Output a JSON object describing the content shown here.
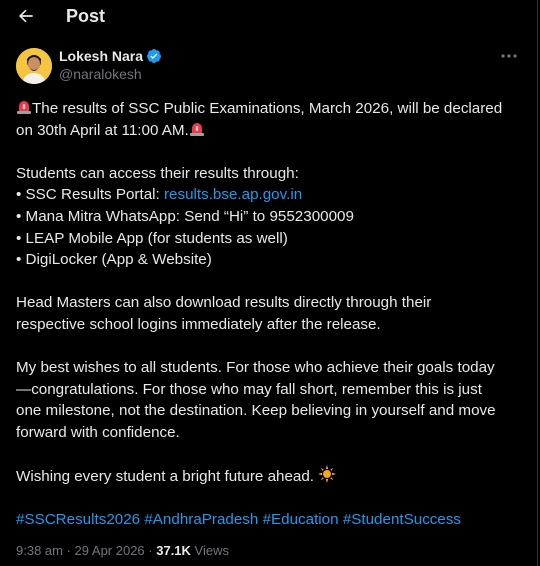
{
  "header": {
    "title": "Post"
  },
  "author": {
    "display_name": "Lokesh Nara",
    "handle": "@naralokesh",
    "verified": true
  },
  "tweet": {
    "line1_part1": "The results of SSC Public Examinations, March 2026, will be declared",
    "line1_part2": "on 30th April at 11:00 AM.",
    "access_intro": "Students can access their results through:",
    "item1_prefix": "• SSC Results Portal: ",
    "item1_link": "results.bse.ap.gov.in",
    "item2": "• Mana Mitra WhatsApp: Send “Hi” to 9552300009",
    "item3": "• LEAP Mobile App (for students as well)",
    "item4": "• DigiLocker (App & Website)",
    "headmasters_l1": "Head Masters can also download results directly through their",
    "headmasters_l2": "respective school logins immediately after the release.",
    "wishes_l1": "My best wishes to all students. For those who achieve their goals today",
    "wishes_l2": "—congratulations. For those who may fall short, remember this is just",
    "wishes_l3": "one milestone, not the destination. Keep believing in yourself and move",
    "wishes_l4": "forward with confidence.",
    "closing": "Wishing every student a bright future ahead. ",
    "hashtags": [
      "#SSCResults2026",
      "#AndhraPradesh",
      "#Education",
      "#StudentSuccess"
    ]
  },
  "meta": {
    "time": "9:38 am",
    "separator": " · ",
    "date": "29 Apr 2026",
    "views_count": "37.1K",
    "views_label": " Views"
  },
  "colors": {
    "background": "#000000",
    "text": "#e7e9ea",
    "muted": "#71767b",
    "link": "#1d9bf0",
    "verified": "#1d9bf0"
  },
  "icons": {
    "back": "arrow-left-icon",
    "verified": "verified-badge-icon",
    "more": "more-horizontal-icon",
    "siren": "siren-emoji-icon",
    "sun": "sun-emoji-icon"
  }
}
